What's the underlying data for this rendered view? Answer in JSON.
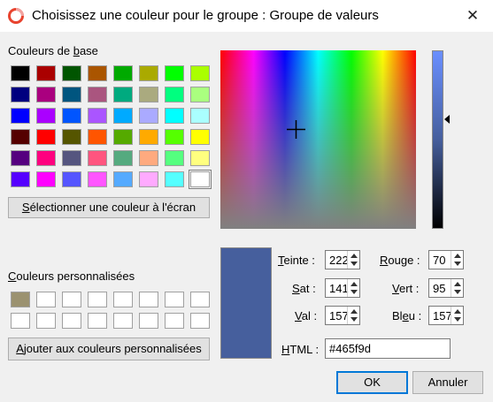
{
  "window": {
    "title": "Choisissez une couleur pour le groupe : Groupe de valeurs",
    "close_glyph": "✕",
    "app_icon": "qgis-ring-icon"
  },
  "basic_colors": {
    "label_before": "Couleurs de ",
    "label_underlined": "b",
    "label_after": "ase",
    "rows": [
      [
        "#000000",
        "#aa0000",
        "#005500",
        "#aa5500",
        "#00aa00",
        "#aaaa00",
        "#00ff00",
        "#aaff00"
      ],
      [
        "#00007f",
        "#aa007f",
        "#00557f",
        "#aa557f",
        "#00aa7f",
        "#aaaa7f",
        "#00ff7f",
        "#aaff7f"
      ],
      [
        "#0000ff",
        "#aa00ff",
        "#0055ff",
        "#aa55ff",
        "#00aaff",
        "#aaaaff",
        "#00ffff",
        "#aaffff"
      ],
      [
        "#550000",
        "#ff0000",
        "#555500",
        "#ff5500",
        "#55aa00",
        "#ffaa00",
        "#55ff00",
        "#ffff00"
      ],
      [
        "#55007f",
        "#ff007f",
        "#55557f",
        "#ff557f",
        "#55aa7f",
        "#ffaa7f",
        "#55ff7f",
        "#ffff7f"
      ],
      [
        "#5500ff",
        "#ff00ff",
        "#5555ff",
        "#ff55ff",
        "#55aaff",
        "#ffaaff",
        "#55ffff",
        "#ffffff"
      ]
    ],
    "selected_index": 47
  },
  "pick_screen_button": {
    "underlined": "S",
    "rest": "électionner une couleur à l'écran"
  },
  "custom_colors": {
    "label_underlined": "C",
    "label_rest": "ouleurs personnalisées",
    "rows": [
      [
        "#9b9270",
        "#ffffff",
        "#ffffff",
        "#ffffff",
        "#ffffff",
        "#ffffff",
        "#ffffff",
        "#ffffff"
      ],
      [
        "#ffffff",
        "#ffffff",
        "#ffffff",
        "#ffffff",
        "#ffffff",
        "#ffffff",
        "#ffffff",
        "#ffffff"
      ]
    ]
  },
  "add_custom_button": {
    "underlined": "A",
    "rest": "jouter aux couleurs personnalisées"
  },
  "picker": {
    "current_color": "#465f9d",
    "value_level": 157
  },
  "fields": {
    "hue": {
      "label_underlined": "T",
      "label_rest": "einte :",
      "value": "222"
    },
    "sat": {
      "label_underlined": "S",
      "label_rest": "at :",
      "value": "141"
    },
    "val": {
      "label_underlined": "V",
      "label_rest": "al :",
      "value": "157"
    },
    "red": {
      "label_underlined": "R",
      "label_rest": "ouge :",
      "value": "70"
    },
    "green": {
      "label_underlined": "V",
      "label_rest": "ert :",
      "value": "95"
    },
    "blue": {
      "label_before": "Bl",
      "label_underlined": "e",
      "label_after": "u :",
      "value": "157"
    },
    "html": {
      "label_underlined": "H",
      "label_rest": "TML :",
      "value": "#465f9d"
    }
  },
  "buttons": {
    "ok": "OK",
    "cancel": "Annuler"
  }
}
